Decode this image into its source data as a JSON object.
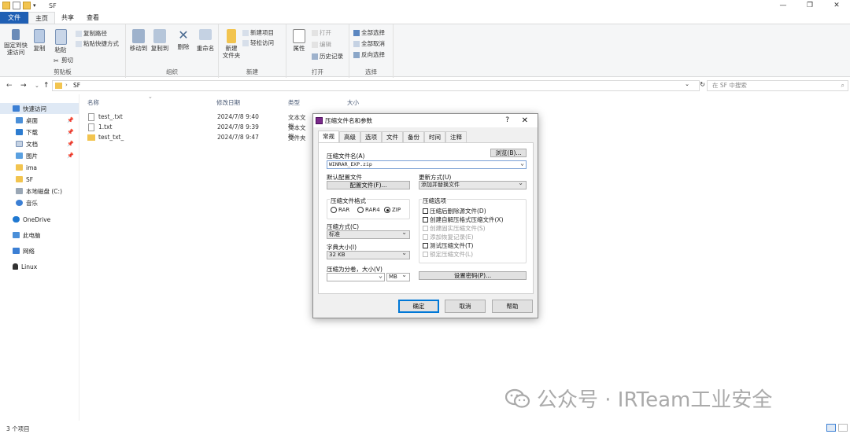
{
  "window": {
    "title": "SF"
  },
  "ribbon_tabs": [
    "文件",
    "主页",
    "共享",
    "查看"
  ],
  "ribbon": {
    "clipboard": {
      "pin": "固定到快\n速访问",
      "copy": "复制",
      "paste": "粘贴",
      "copy_path": "复制路径",
      "paste_shortcut": "粘贴快捷方式",
      "cut": "剪切",
      "label": "剪贴板"
    },
    "organize": {
      "move_to": "移动到",
      "copy_to": "复制到",
      "delete": "删除",
      "rename": "重命名",
      "label": "组织"
    },
    "new": {
      "new_folder": "新建\n文件夹",
      "new_item": "新建项目",
      "easy_access": "轻松访问",
      "label": "新建"
    },
    "open": {
      "properties": "属性",
      "open": "打开",
      "edit": "编辑",
      "history": "历史记录",
      "label": "打开"
    },
    "select": {
      "select_all": "全部选择",
      "select_none": "全部取消",
      "invert": "反向选择",
      "label": "选择"
    }
  },
  "address": {
    "path": "SF",
    "search_placeholder": "在 SF 中搜索"
  },
  "sidebar": [
    {
      "label": "快速访问",
      "pinned": false
    },
    {
      "label": "桌面",
      "pinned": true
    },
    {
      "label": "下载",
      "pinned": true
    },
    {
      "label": "文档",
      "pinned": true
    },
    {
      "label": "图片",
      "pinned": true
    },
    {
      "label": "ima",
      "pinned": false
    },
    {
      "label": "SF",
      "pinned": false
    },
    {
      "label": "本地磁盘 (C:)",
      "pinned": false
    },
    {
      "label": "音乐",
      "pinned": false
    },
    {
      "label": "OneDrive",
      "pinned": false
    },
    {
      "label": "此电脑",
      "pinned": false
    },
    {
      "label": "网络",
      "pinned": false
    },
    {
      "label": "Linux",
      "pinned": false
    }
  ],
  "columns": {
    "name": "名称",
    "date": "修改日期",
    "type": "类型",
    "size": "大小"
  },
  "files": [
    {
      "name": "test_.txt",
      "date": "2024/7/8 9:40",
      "type": "文本文档"
    },
    {
      "name": "1.txt",
      "date": "2024/7/8 9:39",
      "type": "文本文档"
    },
    {
      "name": "test_txt_",
      "date": "2024/7/8 9:47",
      "type": "文件夹"
    }
  ],
  "status": {
    "count": "3 个项目"
  },
  "dialog": {
    "title": "压缩文件名和参数",
    "help_glyph": "?",
    "close_glyph": "✕",
    "tabs": [
      "常规",
      "高级",
      "选项",
      "文件",
      "备份",
      "时间",
      "注释"
    ],
    "archive_name_label": "压缩文件名(A)",
    "browse": "浏览(B)...",
    "archive_name": "WINRAR_EXP.zip",
    "profile_label": "默认配置文件",
    "profile_button": "配置文件(F)...",
    "update_mode_label": "更新方式(U)",
    "update_mode": "添加并替换文件",
    "format_label": "压缩文件格式",
    "formats": [
      "RAR",
      "RAR4",
      "ZIP"
    ],
    "format_selected": "ZIP",
    "options_label": "压缩选项",
    "options": [
      {
        "label": "压缩后删除源文件(D)",
        "enabled": true
      },
      {
        "label": "创建自解压格式压缩文件(X)",
        "enabled": true
      },
      {
        "label": "创建固实压缩文件(S)",
        "enabled": false
      },
      {
        "label": "添加恢复记录(E)",
        "enabled": false
      },
      {
        "label": "测试压缩文件(T)",
        "enabled": true
      },
      {
        "label": "锁定压缩文件(L)",
        "enabled": false
      }
    ],
    "method_label": "压缩方式(C)",
    "method": "标准",
    "dict_label": "字典大小(I)",
    "dict": "32 KB",
    "split_label": "压缩为分卷，大小(V)",
    "split_unit": "MB",
    "password_button": "设置密码(P)...",
    "ok": "确定",
    "cancel": "取消",
    "help": "帮助"
  },
  "watermark": "公众号 · IRTeam工业安全"
}
